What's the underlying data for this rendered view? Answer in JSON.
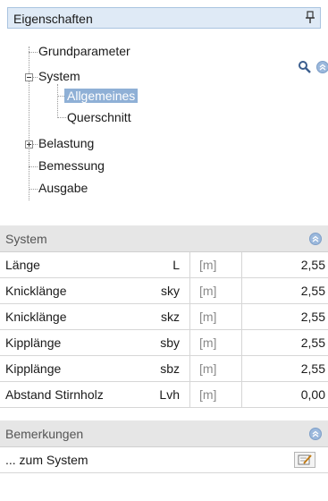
{
  "panel": {
    "title": "Eigenschaften"
  },
  "tree": {
    "items": [
      {
        "label": "Grundparameter"
      },
      {
        "label": "System"
      },
      {
        "label": "Allgemeines"
      },
      {
        "label": "Querschnitt"
      },
      {
        "label": "Belastung"
      },
      {
        "label": "Bemessung"
      },
      {
        "label": "Ausgabe"
      }
    ],
    "selected": "Allgemeines"
  },
  "system": {
    "header": "System",
    "rows": [
      {
        "name": "Länge",
        "symbol": "L",
        "unit": "[m]",
        "value": "2,55"
      },
      {
        "name": "Knicklänge",
        "symbol": "sky",
        "unit": "[m]",
        "value": "2,55"
      },
      {
        "name": "Knicklänge",
        "symbol": "skz",
        "unit": "[m]",
        "value": "2,55"
      },
      {
        "name": "Kipplänge",
        "symbol": "sby",
        "unit": "[m]",
        "value": "2,55"
      },
      {
        "name": "Kipplänge",
        "symbol": "sbz",
        "unit": "[m]",
        "value": "2,55"
      },
      {
        "name": "Abstand Stirnholz",
        "symbol": "Lvh",
        "unit": "[m]",
        "value": "0,00"
      }
    ]
  },
  "remarks": {
    "header": "Bemerkungen",
    "rows": [
      {
        "name": "... zum System"
      }
    ]
  },
  "colors": {
    "accent": "#8fb0d6",
    "header_bg": "#e6e6e6",
    "title_bg": "#dfeaf6"
  },
  "icons": [
    "pin-icon",
    "search-icon",
    "collapse-icon",
    "edit-icon"
  ]
}
